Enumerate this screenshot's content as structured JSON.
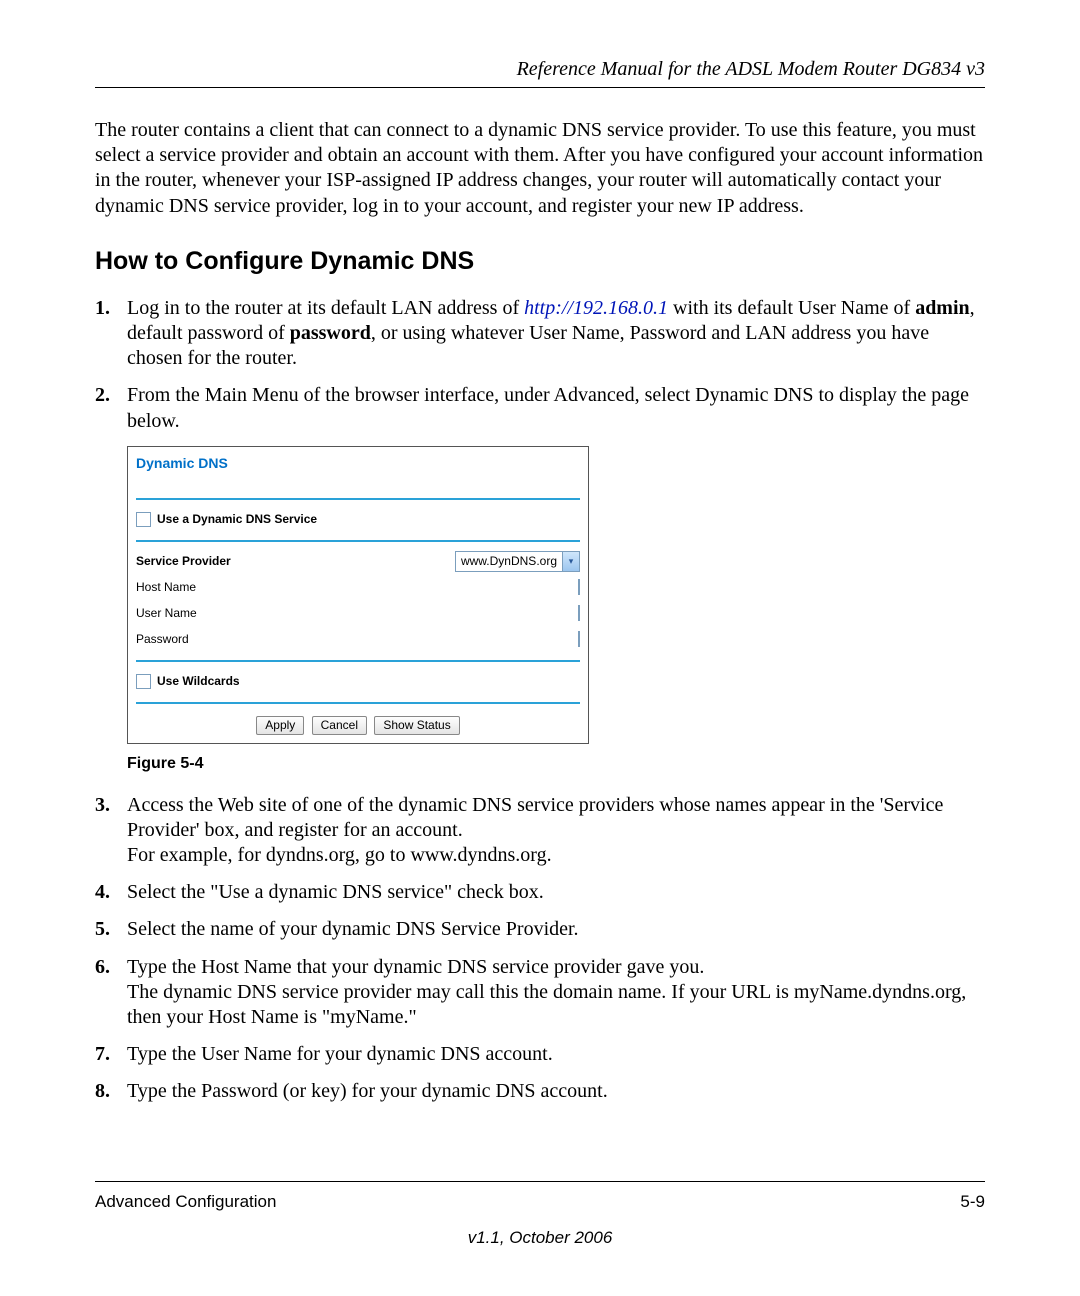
{
  "header": {
    "running_head": "Reference Manual for the ADSL Modem Router DG834 v3"
  },
  "intro": "The router contains a client that can connect to a dynamic DNS service provider. To use this feature, you must select a service provider and obtain an account with them. After you have configured your account information in the router, whenever your ISP-assigned IP address changes, your router will automatically contact your dynamic DNS service provider, log in to your account, and register your new IP address.",
  "section_title": "How to Configure Dynamic DNS",
  "steps": {
    "s1a": "Log in to the router at its default LAN address of ",
    "s1_link": "http://192.168.0.1",
    "s1b": " with its default User Name of ",
    "s1_admin": "admin",
    "s1c": ", default password of ",
    "s1_password": "password",
    "s1d": ", or using whatever User Name, Password and LAN address you have chosen for the router.",
    "s2": "From the Main Menu of the browser interface, under Advanced, select Dynamic DNS to display the page below.",
    "s3a": "Access the Web site of one of the dynamic DNS service providers whose names appear in the 'Service Provider' box, and register for an account.",
    "s3b": "For example, for dyndns.org, go to www.dyndns.org.",
    "s4": "Select the \"Use a dynamic DNS service\" check box.",
    "s5": "Select the name of your dynamic DNS Service Provider.",
    "s6a": "Type the Host Name that your dynamic DNS service provider gave you.",
    "s6b": "The dynamic DNS service provider may call this the domain name. If your URL is myName.dyndns.org, then your Host Name is \"myName.\"",
    "s7": "Type the User Name for your dynamic DNS account.",
    "s8": "Type the Password (or key) for your dynamic DNS account."
  },
  "figure": {
    "caption": "Figure 5-4",
    "panel": {
      "title": "Dynamic DNS",
      "use_service_label": "Use a Dynamic DNS Service",
      "service_provider_label": "Service Provider",
      "service_provider_value": "www.DynDNS.org",
      "host_name_label": "Host Name",
      "user_name_label": "User Name",
      "password_label": "Password",
      "wildcards_label": "Use Wildcards",
      "apply": "Apply",
      "cancel": "Cancel",
      "show_status": "Show Status"
    }
  },
  "footer": {
    "section": "Advanced Configuration",
    "page": "5-9",
    "version": "v1.1, October 2006"
  }
}
